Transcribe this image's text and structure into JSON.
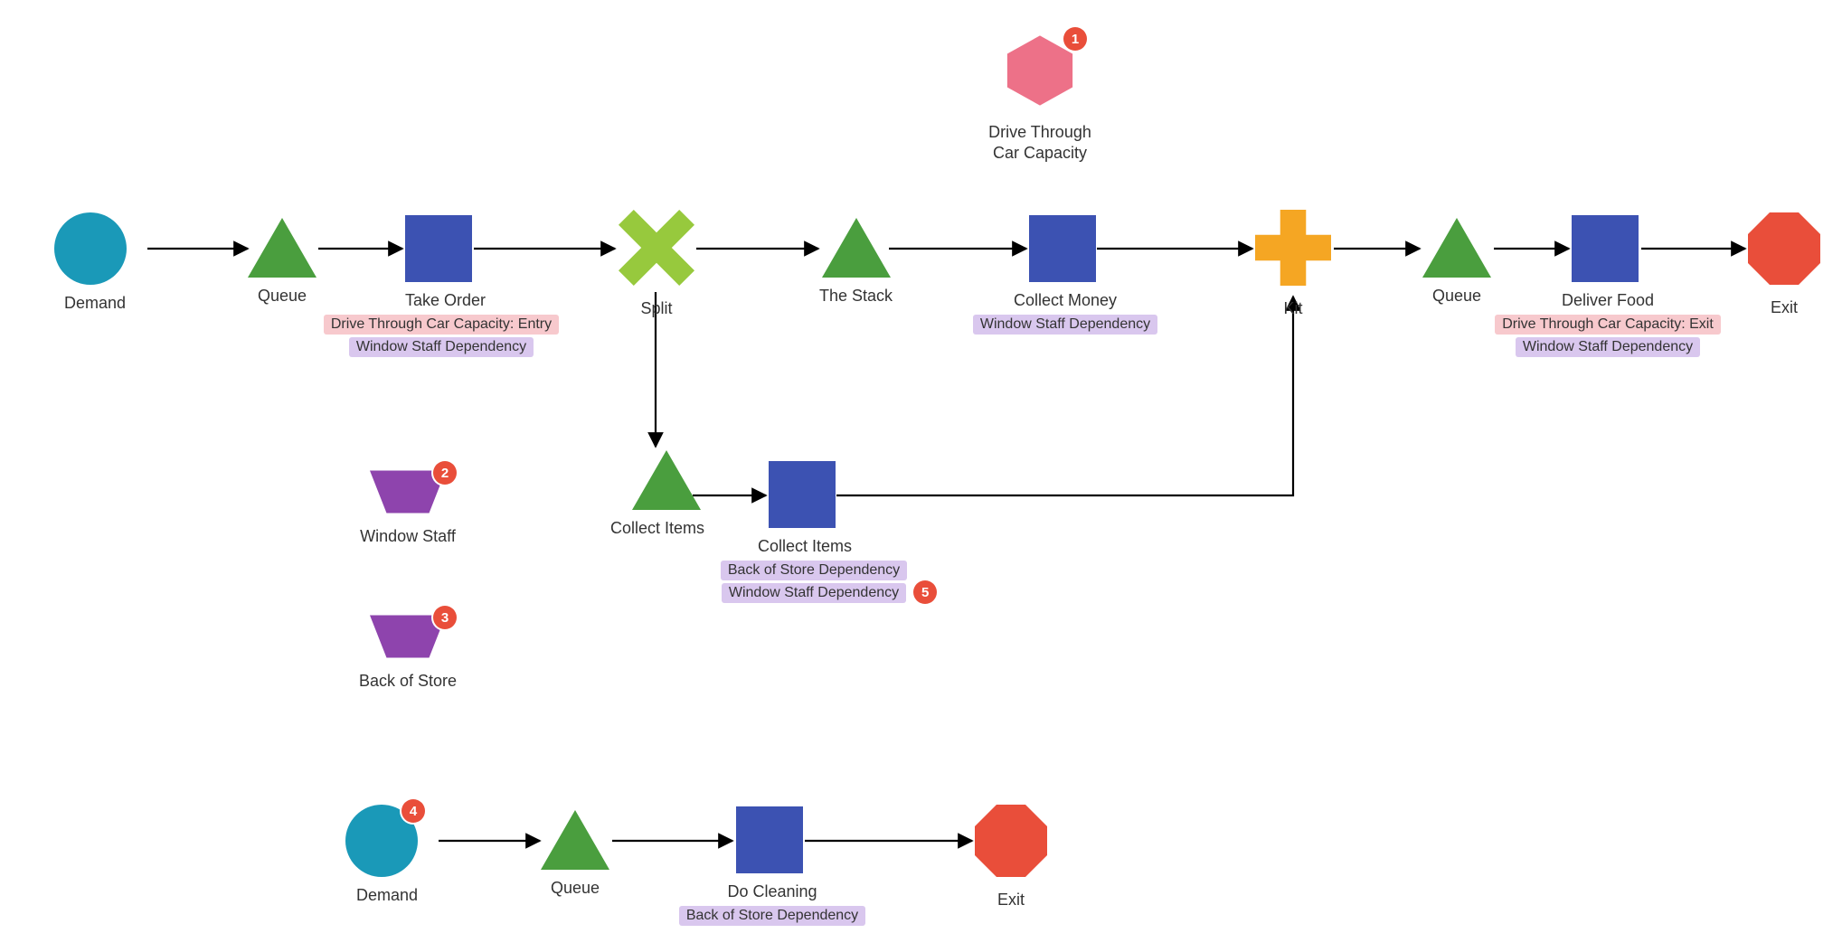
{
  "resources": {
    "car_capacity": {
      "label": "Drive Through\nCar Capacity",
      "badge": "1"
    },
    "window_staff": {
      "label": "Window Staff",
      "badge": "2"
    },
    "back_of_store": {
      "label": "Back of Store",
      "badge": "3"
    }
  },
  "main_flow": {
    "demand": {
      "label": "Demand"
    },
    "queue1": {
      "label": "Queue"
    },
    "take_order": {
      "label": "Take Order",
      "tag_pink": "Drive Through Car Capacity: Entry",
      "tag_purple": "Window Staff Dependency"
    },
    "split": {
      "label": "Split"
    },
    "the_stack": {
      "label": "The Stack"
    },
    "collect_money": {
      "label": "Collect Money",
      "tag_purple": "Window Staff Dependency"
    },
    "kit": {
      "label": "Kit"
    },
    "queue2": {
      "label": "Queue"
    },
    "deliver_food": {
      "label": "Deliver Food",
      "tag_pink": "Drive Through Car Capacity: Exit",
      "tag_purple": "Window Staff Dependency"
    },
    "exit": {
      "label": "Exit"
    }
  },
  "branch_flow": {
    "collect_items_q": {
      "label": "Collect Items"
    },
    "collect_items_a": {
      "label": "Collect Items",
      "tag_purple_top": "Back of Store Dependency",
      "tag_purple_bot": "Window Staff Dependency",
      "badge": "5"
    }
  },
  "cleaning_flow": {
    "demand2": {
      "label": "Demand",
      "badge": "4"
    },
    "queue3": {
      "label": "Queue"
    },
    "do_cleaning": {
      "label": "Do Cleaning",
      "tag_purple": "Back of Store Dependency"
    },
    "exit2": {
      "label": "Exit"
    }
  },
  "colors": {
    "demand_circle": "#1a99b8",
    "queue_triangle": "#4a9e3e",
    "activity_square": "#3c52b2",
    "split_x": "#97c93d",
    "kit_plus": "#f5a623",
    "exit_octagon": "#e94e3a",
    "resource_hex": "#ed7188",
    "staff_trap": "#8e44ad",
    "badge": "#e94e3a"
  }
}
